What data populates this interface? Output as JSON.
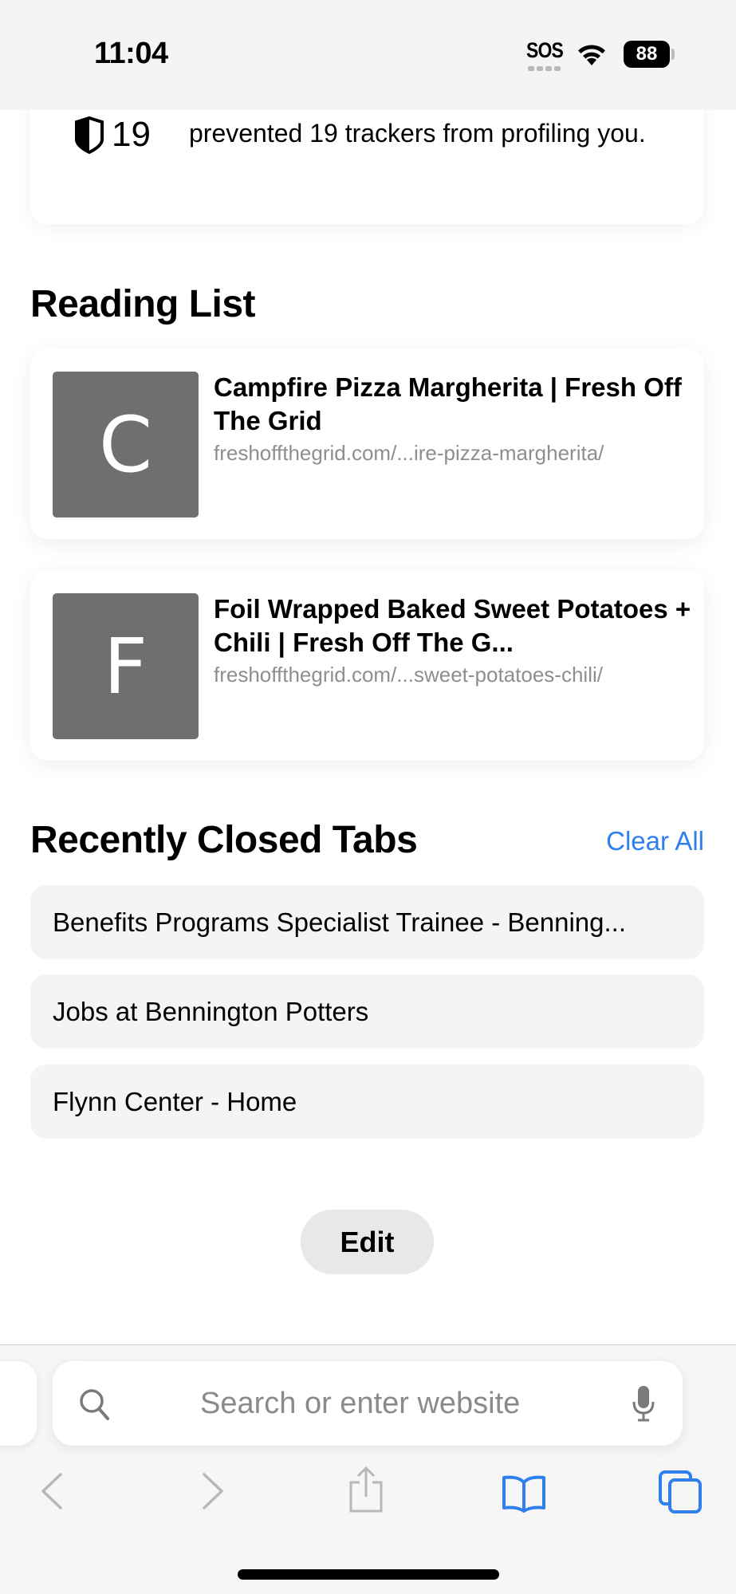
{
  "status_bar": {
    "time": "11:04",
    "sos_label": "SOS",
    "battery_level": "88",
    "icons": [
      "sos-icon",
      "wifi-icon",
      "battery-icon"
    ]
  },
  "privacy_report": {
    "tracker_count": "19",
    "icon": "shield-icon",
    "text": "prevented 19 trackers from profiling you."
  },
  "reading_list": {
    "title": "Reading List",
    "items": [
      {
        "thumb_letter": "C",
        "title": "Campfire Pizza Margherita | Fresh Off The Grid",
        "url": "freshoffthegrid.com/...ire-pizza-margherita/"
      },
      {
        "thumb_letter": "F",
        "title": "Foil Wrapped Baked Sweet Potatoes + Chili | Fresh Off The G...",
        "url": "freshoffthegrid.com/...sweet-potatoes-chili/"
      }
    ]
  },
  "recently_closed": {
    "title": "Recently Closed Tabs",
    "clear_all_label": "Clear All",
    "items": [
      "Benefits Programs Specialist Trainee - Benning...",
      "Jobs at Bennington Potters",
      "Flynn Center - Home"
    ]
  },
  "edit_label": "Edit",
  "toolbar": {
    "search_placeholder": "Search or enter website",
    "icons": [
      "search-icon",
      "microphone-icon",
      "back-icon",
      "forward-icon",
      "share-icon",
      "bookmarks-icon",
      "tabs-icon"
    ]
  },
  "colors": {
    "accent": "#2f80ed",
    "thumb_bg": "#6f6f6f",
    "row_bg": "#f4f4f4",
    "muted_text": "#8e8e8e"
  }
}
